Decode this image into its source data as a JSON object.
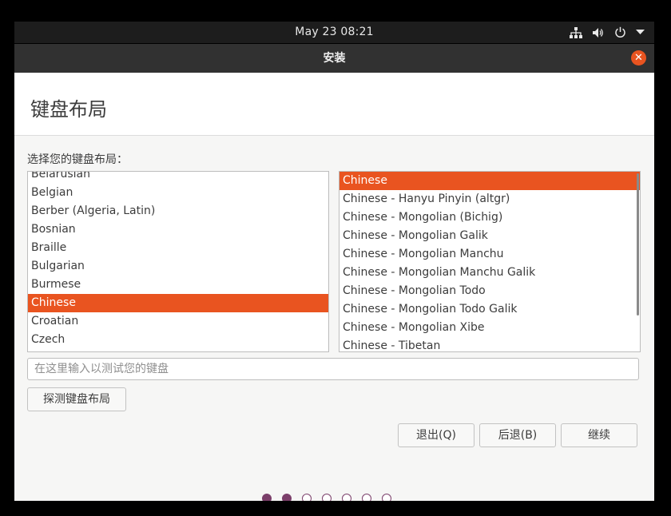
{
  "topbar": {
    "clock": "May 23  08:21",
    "icons": [
      "network-icon",
      "volume-icon",
      "power-icon",
      "menu-down-icon"
    ]
  },
  "window": {
    "title": "安装",
    "close_icon": "close-icon"
  },
  "page": {
    "title": "键盘布局",
    "prompt": "选择您的键盘布局："
  },
  "layouts": {
    "items": [
      "Belarusian",
      "Belgian",
      "Berber (Algeria, Latin)",
      "Bosnian",
      "Braille",
      "Bulgarian",
      "Burmese",
      "Chinese",
      "Croatian",
      "Czech"
    ],
    "selected": "Chinese"
  },
  "variants": {
    "items": [
      "Chinese",
      "Chinese - Hanyu Pinyin (altgr)",
      "Chinese - Mongolian (Bichig)",
      "Chinese - Mongolian Galik",
      "Chinese - Mongolian Manchu",
      "Chinese - Mongolian Manchu Galik",
      "Chinese - Mongolian Todo",
      "Chinese - Mongolian Todo Galik",
      "Chinese - Mongolian Xibe",
      "Chinese - Tibetan"
    ],
    "selected": "Chinese"
  },
  "test": {
    "placeholder": "在这里输入以测试您的键盘",
    "value": ""
  },
  "buttons": {
    "detect": "探测键盘布局",
    "quit": "退出(Q)",
    "back": "后退(B)",
    "continue": "继续"
  },
  "progress": {
    "total_steps": 7,
    "completed_steps": 2
  },
  "colors": {
    "accent": "#e95420",
    "titlebar": "#313131",
    "progress_dot": "#7b3f6a"
  }
}
